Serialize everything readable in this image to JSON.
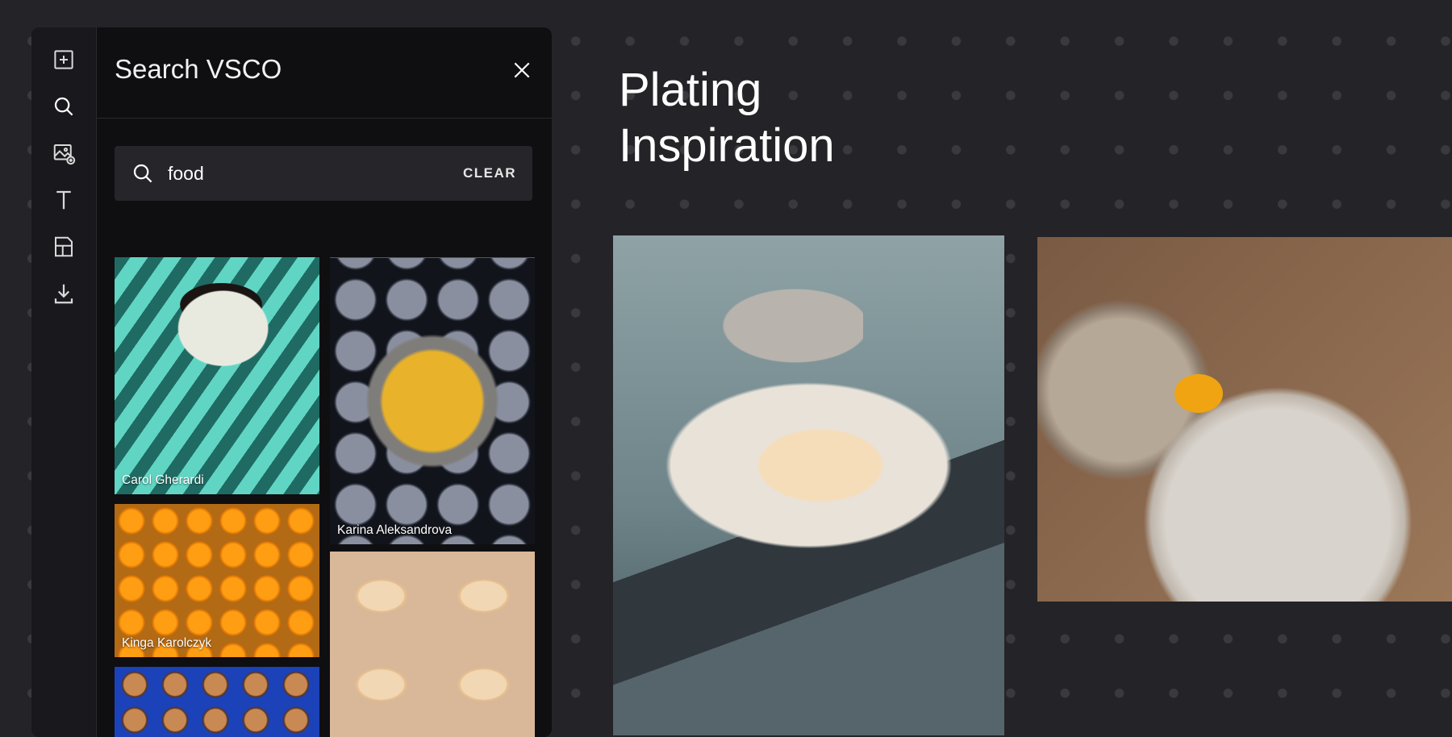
{
  "search_panel": {
    "title": "Search VSCO",
    "query": "food",
    "clear_label": "CLEAR",
    "results": [
      {
        "credit": "Carol Gherardi"
      },
      {
        "credit": "Karina Aleksandrova"
      },
      {
        "credit": "Kinga Karolczyk"
      },
      {
        "credit": ""
      },
      {
        "credit": ""
      }
    ]
  },
  "tool_rail": {
    "icons": [
      "add-frame-icon",
      "search-icon",
      "add-image-icon",
      "text-icon",
      "layout-icon",
      "download-icon"
    ]
  },
  "board": {
    "title_line1": "Plating",
    "title_line2": "Inspiration"
  },
  "colors": {
    "background": "#242327",
    "panel": "#0f0e11",
    "rail": "#19181c",
    "search_box": "#26252a"
  }
}
